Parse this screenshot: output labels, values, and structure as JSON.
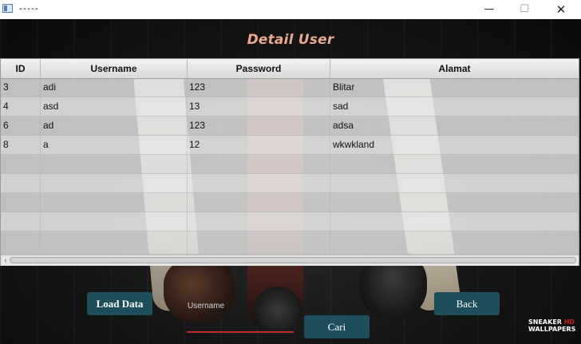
{
  "window": {
    "title": "-----",
    "minimize": "—",
    "maximize": "☐",
    "close": "✕"
  },
  "heading": "Detail User",
  "table": {
    "columns": [
      "ID",
      "Username",
      "Password",
      "Alamat"
    ],
    "rows": [
      {
        "id": "3",
        "username": "adi",
        "password": "123",
        "alamat": "Blitar"
      },
      {
        "id": "4",
        "username": "asd",
        "password": "13",
        "alamat": "sad"
      },
      {
        "id": "6",
        "username": "ad",
        "password": "123",
        "alamat": "adsa"
      },
      {
        "id": "8",
        "username": "a",
        "password": "12",
        "alamat": "wkwkland"
      }
    ],
    "scroll_left_icon": "‹"
  },
  "controls": {
    "load_label": "Load Data",
    "username_label": "Username",
    "username_value": "",
    "cari_label": "Cari",
    "back_label": "Back"
  },
  "logo": {
    "line1": "SNEAKER",
    "line1_accent": "HD",
    "line2": "WALLPAPERS"
  },
  "colors": {
    "accent_button": "#1e4e5c",
    "heading": "#e8a98c",
    "input_underline": "#c0262b"
  }
}
